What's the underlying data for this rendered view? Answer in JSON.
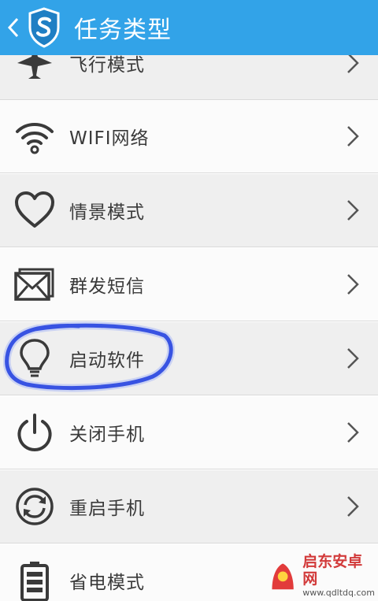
{
  "header": {
    "title": "任务类型",
    "colors": {
      "bar": "#32a3e8",
      "logo_fill": "#1f7fc4"
    }
  },
  "items": [
    {
      "label": "飞行模式",
      "icon": "airplane-icon"
    },
    {
      "label": "WIFI网络",
      "icon": "wifi-icon"
    },
    {
      "label": "情景模式",
      "icon": "heart-icon"
    },
    {
      "label": "群发短信",
      "icon": "envelope-icon"
    },
    {
      "label": "启动软件",
      "icon": "lightbulb-icon"
    },
    {
      "label": "关闭手机",
      "icon": "power-icon"
    },
    {
      "label": "重启手机",
      "icon": "restart-icon"
    },
    {
      "label": "省电模式",
      "icon": "battery-icon"
    }
  ],
  "highlight": {
    "color": "#1733d6",
    "target": "启动软件"
  },
  "watermark": {
    "name": "启东安卓网",
    "url": "www.qdltdq.com"
  }
}
